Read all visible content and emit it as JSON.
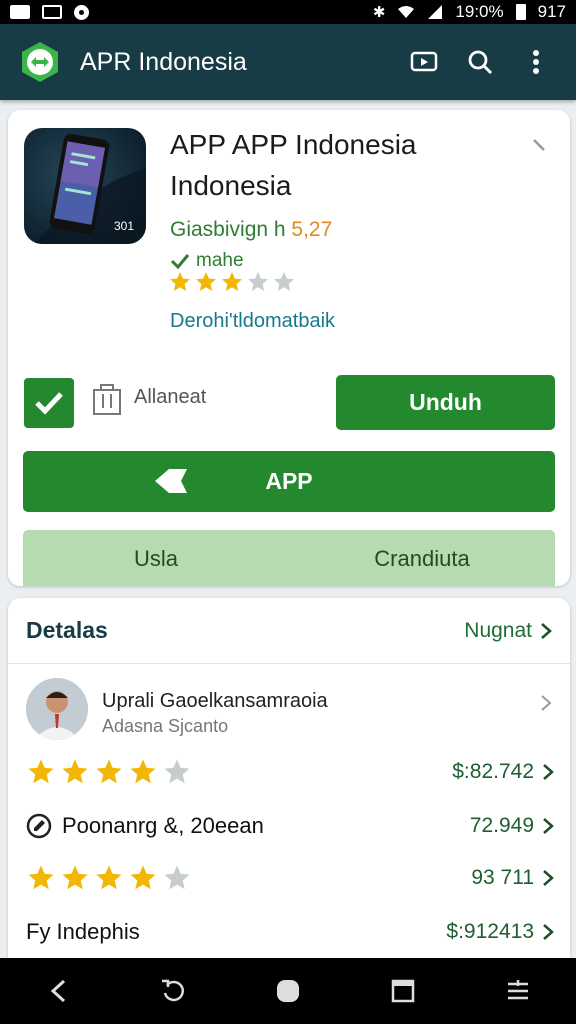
{
  "status_bar": {
    "right_text": "19:0%",
    "time": "917"
  },
  "app_bar": {
    "title": "APR Indonesia",
    "icons": [
      "hex-arrows-logo",
      "play-screen-icon",
      "search-icon",
      "more-vertical-icon"
    ]
  },
  "app_card": {
    "name": "APP APP Indonesia Indonesia",
    "developer": "Giasbivign h",
    "price": "5,27",
    "verified_label": "mahe",
    "rating_stars": 3,
    "link_text": "Derohi'tldomatbaik",
    "bag_label": "Allaneat",
    "download_button": "Unduh",
    "app_button": "APP",
    "tabs": [
      "Usla",
      "Crandiuta"
    ],
    "icon_badge": "301"
  },
  "details": {
    "title": "Detalas",
    "more_label": "Nugnat",
    "reviewer": {
      "name": "Uprali Gaoelkansamraoia",
      "subtitle": "Adasna Sjcanto"
    },
    "rows": [
      {
        "type": "stars",
        "stars": 4,
        "value": "$:82.742"
      },
      {
        "type": "text",
        "icon": "edit-circle-icon",
        "text": "Poonanrg &, 20eean",
        "value": "72.949"
      },
      {
        "type": "stars",
        "stars": 4,
        "value": "93 711"
      },
      {
        "type": "text",
        "text": "Fy Indephis",
        "value": "$:912413"
      }
    ]
  },
  "colors": {
    "app_bar": "#173c46",
    "primary_green": "#24882f",
    "soft_green": "#b6dbb0",
    "star": "#f2b705"
  },
  "nav_bar": {
    "icons": [
      "back-icon",
      "refresh-icon",
      "home-icon",
      "recents-icon",
      "menu-icon"
    ]
  }
}
